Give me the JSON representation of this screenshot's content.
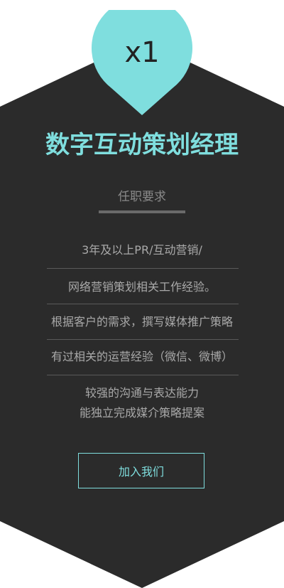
{
  "badge": {
    "label": "x1"
  },
  "job": {
    "title": "数字互动策划经理",
    "subtitle": "任职要求",
    "requirements": [
      "3年及以上PR/互动营销/",
      "网络营销策划相关工作经验。",
      "根据客户的需求，撰写媒体推广策略",
      "有过相关的运营经验（微信、微博）",
      "较强的沟通与表达能力",
      "能独立完成媒介策略提案"
    ]
  },
  "actions": {
    "join_label": "加入我们"
  },
  "colors": {
    "accent": "#7fdede",
    "card": "#2b2b2b",
    "text_muted": "#a9a9a9"
  }
}
